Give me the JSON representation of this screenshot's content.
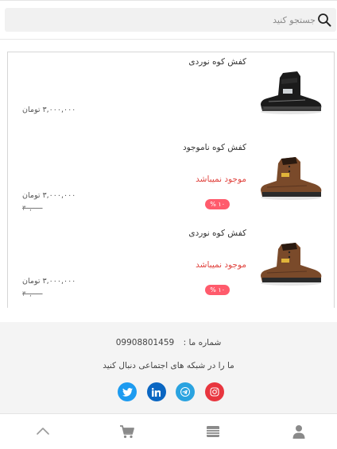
{
  "search": {
    "placeholder": "جستجو کنید",
    "value": ""
  },
  "products": [
    {
      "title": "کفش کوه نوردی",
      "status": "",
      "discount_badge": "",
      "price": "۳,۰۰۰,۰۰۰ تومان",
      "old_price": "",
      "shoe_color": "#1b1b1b"
    },
    {
      "title": "کفش کوه ناموجود",
      "status": "موجود نمیباشد",
      "discount_badge": "۱۰ %",
      "price": "۳,۰۰۰,۰۰۰ تومان",
      "old_price": "۳۰,۰۰۰",
      "shoe_color": "#7a4a2a"
    },
    {
      "title": "کفش کوه نوردی",
      "status": "موجود نمیباشد",
      "discount_badge": "۱۰ %",
      "price": "۳,۰۰۰,۰۰۰ تومان",
      "old_price": "۳۰,۰۰۰",
      "shoe_color": "#7a4a2a"
    }
  ],
  "footer": {
    "phone_label": "شماره ما :",
    "phone_number": "09908801459",
    "social_text": "ما را در شبکه های اجتماعی دنبال کنید",
    "socials": [
      {
        "name": "twitter",
        "color": "#1d9bf0"
      },
      {
        "name": "linkedin",
        "color": "#0a66c2"
      },
      {
        "name": "telegram",
        "color": "#2aa3e0"
      },
      {
        "name": "instagram",
        "color": "#e8363f"
      }
    ]
  },
  "bottom_nav": [
    "user-icon",
    "menu-icon",
    "cart-icon",
    "chevron-up-icon"
  ]
}
